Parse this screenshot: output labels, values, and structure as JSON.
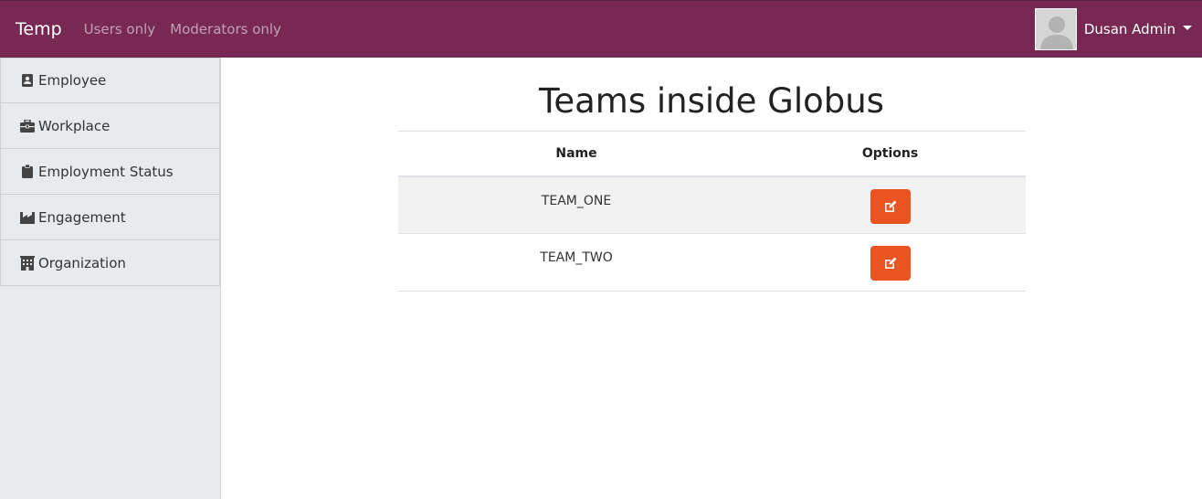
{
  "navbar": {
    "brand": "Temp",
    "links": [
      {
        "label": "Users only"
      },
      {
        "label": "Moderators only"
      }
    ],
    "user": {
      "name": "Dusan Admin"
    }
  },
  "sidebar": {
    "items": [
      {
        "label": "Employee",
        "icon": "id-card-icon"
      },
      {
        "label": "Workplace",
        "icon": "briefcase-icon"
      },
      {
        "label": "Employment Status",
        "icon": "clipboard-icon"
      },
      {
        "label": "Engagement",
        "icon": "industry-icon"
      },
      {
        "label": "Organization",
        "icon": "building-icon"
      }
    ]
  },
  "main": {
    "title": "Teams inside Globus",
    "table": {
      "headers": [
        "Name",
        "Options"
      ],
      "rows": [
        {
          "name": "TEAM_ONE"
        },
        {
          "name": "TEAM_TWO"
        }
      ]
    }
  },
  "colors": {
    "navbar_bg": "#772953",
    "accent": "#e95420",
    "sidebar_bg": "#e8ebee"
  }
}
